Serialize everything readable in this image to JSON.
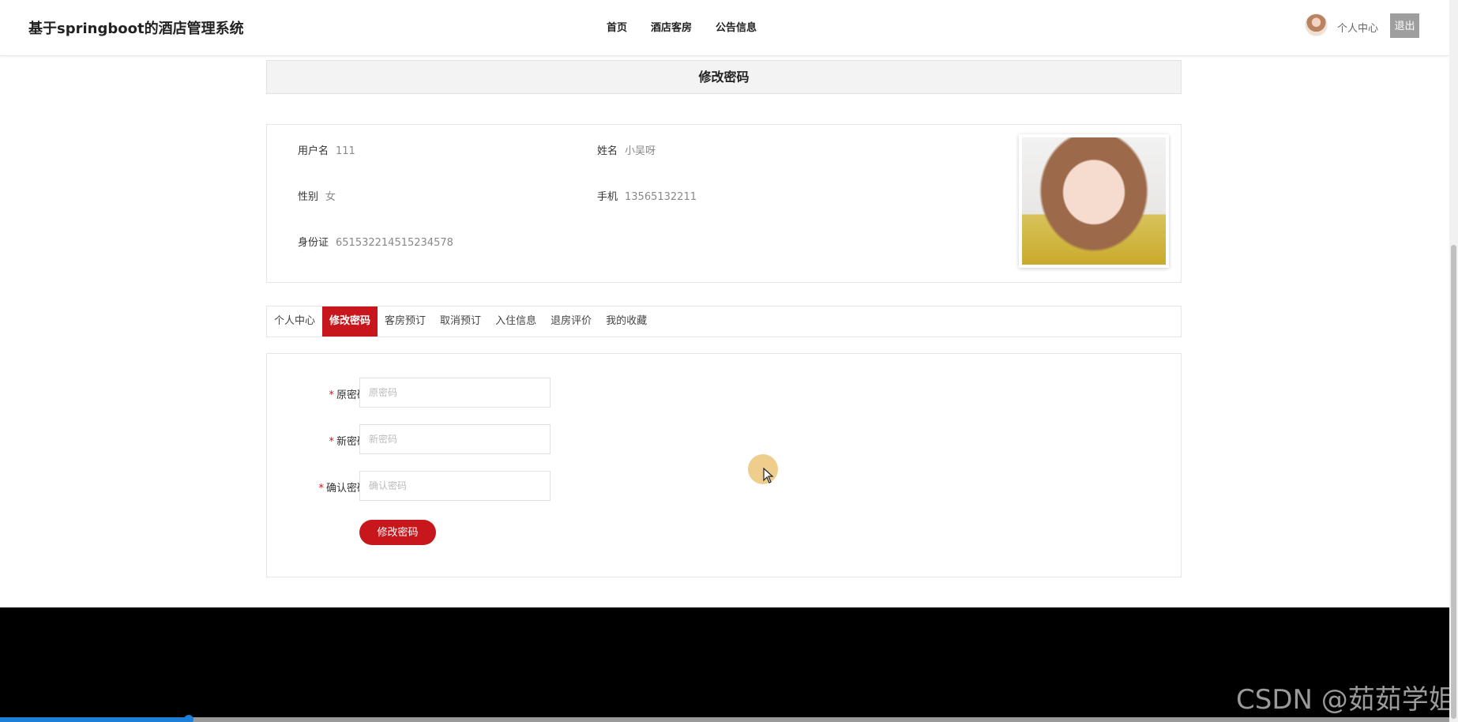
{
  "header": {
    "site_title": "基于springboot的酒店管理系统",
    "nav": [
      {
        "label": "首页"
      },
      {
        "label": "酒店客房"
      },
      {
        "label": "公告信息"
      }
    ],
    "personal_center": "个人中心",
    "logout": "退出"
  },
  "page": {
    "section_title": "修改密码"
  },
  "profile": {
    "username_label": "用户名",
    "username": "111",
    "name_label": "姓名",
    "name": "小吴呀",
    "gender_label": "性别",
    "gender": "女",
    "phone_label": "手机",
    "phone": "13565132211",
    "id_label": "身份证",
    "id_number": "651532214515234578"
  },
  "tabs": [
    {
      "label": "个人中心",
      "active": false
    },
    {
      "label": "修改密码",
      "active": true
    },
    {
      "label": "客房预订",
      "active": false
    },
    {
      "label": "取消预订",
      "active": false
    },
    {
      "label": "入住信息",
      "active": false
    },
    {
      "label": "退房评价",
      "active": false
    },
    {
      "label": "我的收藏",
      "active": false
    }
  ],
  "form": {
    "required_mark": "*",
    "old_password": {
      "label": "原密码",
      "placeholder": "原密码",
      "value": ""
    },
    "new_password": {
      "label": "新密码",
      "placeholder": "新密码",
      "value": ""
    },
    "confirm_password": {
      "label": "确认密码",
      "placeholder": "确认密码",
      "value": ""
    },
    "submit_label": "修改密码"
  },
  "colors": {
    "accent": "#c8161d",
    "footer": "#000000",
    "progress": "#1e7fd8"
  },
  "video_progress": 0.13,
  "watermark": "CSDN @茹茹学姐"
}
